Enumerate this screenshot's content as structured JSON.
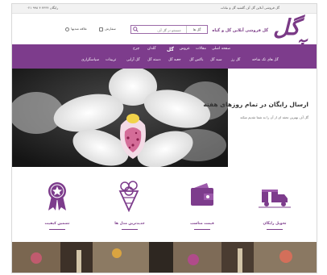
{
  "topbar": {
    "promo": "گل فروشی آنلاین گل آف گلشید گل و نباتات",
    "phone": "رایگان ۴۴۴۴ ۴ ۹۹۸ ۰۲۱"
  },
  "header": {
    "logo": "گل آف",
    "tagline": "گل فروشی آنلاین گل و گیاه",
    "search_all": "گل ها",
    "search_placeholder": "جستجو در گل آف",
    "cart_label": "سفارش",
    "wishlist_label": "علاقه مندیها"
  },
  "nav": {
    "row1": [
      "صفحه اصلی",
      "مقالات",
      "عروس",
      "گل",
      "گلدان",
      "چرخ"
    ],
    "row2": [
      "گل های تک شاخه",
      "گل رز",
      "سبد گل",
      "باکس گل",
      "جعبه گل",
      "دسته گل",
      "گل آرایی",
      "تزیینات",
      "سپاسگزاری"
    ]
  },
  "hero": {
    "title": "ارسال رایگان در تمام روزهای هفته",
    "subtitle": "گل آف بهترین تحفه ای از آن را به شما تقدیم میکند"
  },
  "features": [
    {
      "label": "تحویل رایگان",
      "icon": "gift-truck-icon"
    },
    {
      "label": "قیمت مناسب",
      "icon": "wallet-icon"
    },
    {
      "label": "جدیدترین مدل ها",
      "icon": "bouquet-icon"
    },
    {
      "label": "تضمین کیفیت",
      "icon": "ribbon-badge-icon"
    }
  ],
  "colors": {
    "brand_purple": "#7d3c8c",
    "logo_purple": "#7a3a86"
  }
}
